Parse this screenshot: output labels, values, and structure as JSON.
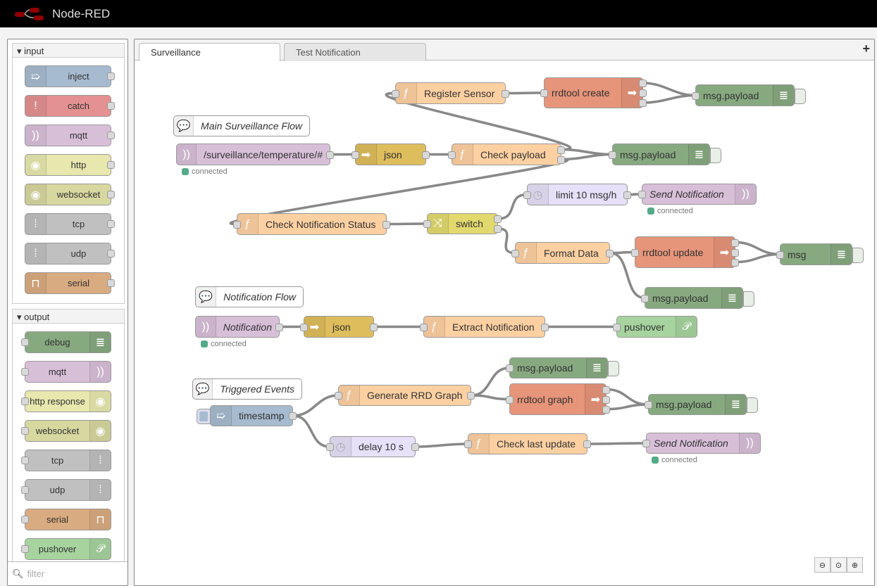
{
  "app": {
    "title": "Node-RED"
  },
  "palette": {
    "categories": [
      {
        "name": "input",
        "nodes": [
          {
            "label": "inject",
            "icon": "arrow-in-icon",
            "color": "#a6bbcf"
          },
          {
            "label": "catch",
            "icon": "alert-icon",
            "color": "#e49191"
          },
          {
            "label": "mqtt",
            "icon": "bridge-icon",
            "color": "#d8bfd8"
          },
          {
            "label": "http",
            "icon": "globe-icon",
            "color": "#e7e7ae"
          },
          {
            "label": "websocket",
            "icon": "globe-icon",
            "color": "#d7d7a0"
          },
          {
            "label": "tcp",
            "icon": "bridge-dash-icon",
            "color": "#c0c0c0"
          },
          {
            "label": "udp",
            "icon": "bridge-dash-icon",
            "color": "#c0c0c0"
          },
          {
            "label": "serial",
            "icon": "serial-icon",
            "color": "#d9ab80"
          }
        ]
      },
      {
        "name": "output",
        "nodes": [
          {
            "label": "debug",
            "icon": "debug-icon",
            "color": "#87a980"
          },
          {
            "label": "mqtt",
            "icon": "bridge-icon",
            "color": "#d8bfd8"
          },
          {
            "label": "http response",
            "icon": "globe-icon",
            "color": "#e7e7ae"
          },
          {
            "label": "websocket",
            "icon": "globe-icon",
            "color": "#d7d7a0"
          },
          {
            "label": "tcp",
            "icon": "bridge-dash-icon",
            "color": "#c0c0c0"
          },
          {
            "label": "udp",
            "icon": "bridge-dash-icon",
            "color": "#c0c0c0"
          },
          {
            "label": "serial",
            "icon": "serial-icon",
            "color": "#d9ab80"
          },
          {
            "label": "pushover",
            "icon": "pushover-icon",
            "color": "#a6d39e"
          }
        ]
      }
    ],
    "filter_placeholder": "filter"
  },
  "workspace": {
    "tabs": [
      {
        "label": "Surveillance",
        "active": true
      },
      {
        "label": "Test Notification",
        "active": false
      }
    ],
    "add_tab": "+",
    "status_connected": "connected",
    "nodes": [
      {
        "label": "Register Sensor",
        "type": "function",
        "color": "#fdd0a2"
      },
      {
        "label": "rrdtool create",
        "type": "rrdtool",
        "color": "#e6947a"
      },
      {
        "label": "msg.payload",
        "type": "debug",
        "color": "#87a980"
      },
      {
        "label": "Main Surveillance Flow",
        "type": "comment",
        "color": "#ffffff"
      },
      {
        "label": "/surveillance/temperature/#",
        "type": "mqtt in",
        "color": "#d8bfd8",
        "status": "connected"
      },
      {
        "label": "json",
        "type": "json",
        "color": "#debd5c"
      },
      {
        "label": "Check payload",
        "type": "function",
        "color": "#fdd0a2"
      },
      {
        "label": "msg.payload",
        "type": "debug",
        "color": "#87a980"
      },
      {
        "label": "limit 10 msg/h",
        "type": "delay",
        "color": "#e6e0f8"
      },
      {
        "label": "Send Notification",
        "type": "mqtt out",
        "color": "#d8bfd8",
        "status": "connected"
      },
      {
        "label": "Check Notification Status",
        "type": "function",
        "color": "#fdd0a2"
      },
      {
        "label": "switch",
        "type": "switch",
        "color": "#e2d96e"
      },
      {
        "label": "Format Data",
        "type": "function",
        "color": "#fdd0a2"
      },
      {
        "label": "rrdtool update",
        "type": "rrdtool",
        "color": "#e6947a"
      },
      {
        "label": "msg",
        "type": "debug",
        "color": "#87a980"
      },
      {
        "label": "msg.payload",
        "type": "debug",
        "color": "#87a980"
      },
      {
        "label": "Notification Flow",
        "type": "comment",
        "color": "#ffffff"
      },
      {
        "label": "Notification",
        "type": "mqtt in",
        "color": "#d8bfd8",
        "status": "connected"
      },
      {
        "label": "json",
        "type": "json",
        "color": "#debd5c"
      },
      {
        "label": "Extract Notification",
        "type": "function",
        "color": "#fdd0a2"
      },
      {
        "label": "pushover",
        "type": "pushover",
        "color": "#a6d39e"
      },
      {
        "label": "msg.payload",
        "type": "debug",
        "color": "#87a980"
      },
      {
        "label": "Triggered Events",
        "type": "comment",
        "color": "#ffffff"
      },
      {
        "label": "timestamp",
        "type": "inject",
        "color": "#a6bbcf"
      },
      {
        "label": "Generate RRD Graph",
        "type": "function",
        "color": "#fdd0a2"
      },
      {
        "label": "rrdtool graph",
        "type": "rrdtool",
        "color": "#e6947a"
      },
      {
        "label": "msg.payload",
        "type": "debug",
        "color": "#87a980"
      },
      {
        "label": "delay 10 s",
        "type": "delay",
        "color": "#e6e0f8"
      },
      {
        "label": "Check last update",
        "type": "function",
        "color": "#fdd0a2"
      },
      {
        "label": "Send Notification",
        "type": "mqtt out",
        "color": "#d8bfd8",
        "status": "connected"
      }
    ],
    "zoom_controls": [
      "zoom-out",
      "zoom-reset",
      "zoom-in"
    ]
  }
}
